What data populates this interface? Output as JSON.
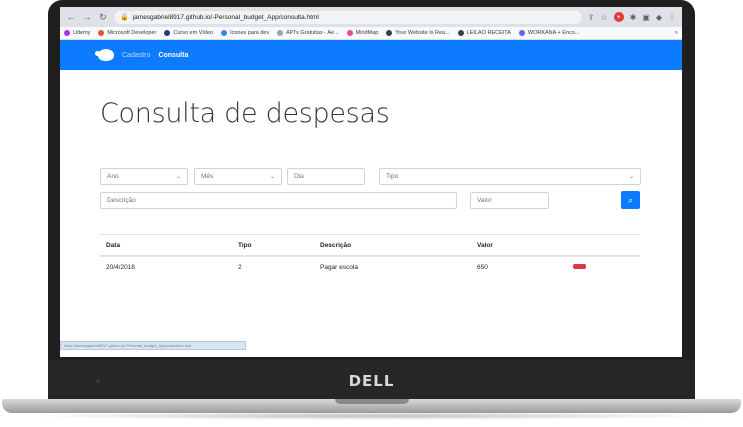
{
  "browser": {
    "url": "jamesgabriel8917.github.io/-Personal_budget_App/consulta.html",
    "bookmarks": [
      {
        "label": "Udemy",
        "color": "#a435f0"
      },
      {
        "label": "Microsoft Developer",
        "color": "#f25022"
      },
      {
        "label": "Curso em Vídeo",
        "color": "#1e3a8a"
      },
      {
        "label": "Icones para dev",
        "color": "#3b82f6"
      },
      {
        "label": "API's Gratuitas - Ae...",
        "color": "#9ca3af"
      },
      {
        "label": "MindMap",
        "color": "#ec4899"
      },
      {
        "label": "Your Website Is Rea...",
        "color": "#374151"
      },
      {
        "label": "LEILAO RECEITA",
        "color": "#374151"
      },
      {
        "label": "WORKANA + Enco...",
        "color": "#6366f1"
      }
    ],
    "status_text": "https://jamesgabriel8917.github.io/-Personal_budget_App/cadastro.html"
  },
  "navbar": {
    "links": [
      "Cadastro",
      "Consulta"
    ],
    "active": "Consulta",
    "accent": "#0d7bff"
  },
  "page": {
    "title": "Consulta de despesas"
  },
  "filters": {
    "ano": "Ano",
    "mes": "Mês",
    "dia_placeholder": "Dia",
    "tipo": "Tipo",
    "descricao_placeholder": "Descrição",
    "valor_placeholder": "Valor"
  },
  "table": {
    "headers": [
      "Data",
      "Tipo",
      "Descrição",
      "Valor"
    ],
    "rows": [
      {
        "data": "20/4/2018",
        "tipo": "2",
        "descricao": "Pagar escola",
        "valor": "650"
      }
    ]
  },
  "laptop": {
    "brand": "DELL"
  }
}
